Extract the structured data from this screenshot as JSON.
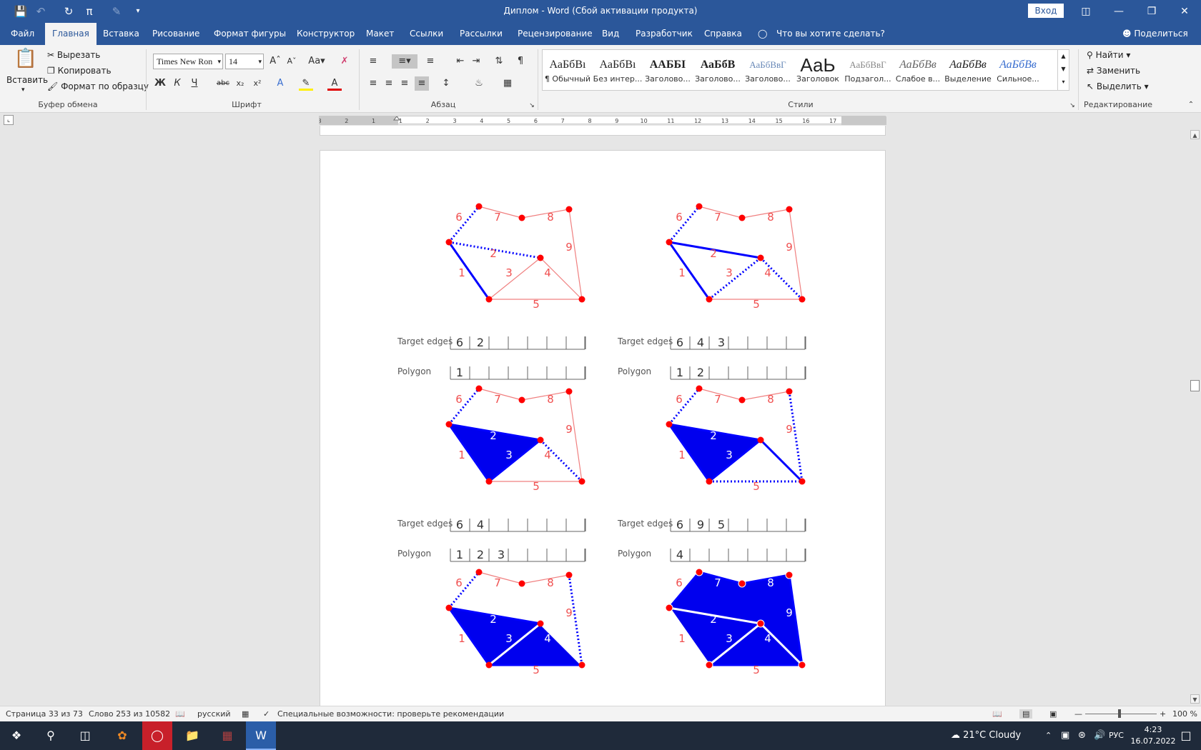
{
  "titlebar": {
    "title": "Диплом  -  Word (Сбой активации продукта)",
    "signin": "Вход"
  },
  "menu": {
    "items": [
      "Файл",
      "Главная",
      "Вставка",
      "Рисование",
      "Формат фигуры",
      "Конструктор",
      "Макет",
      "Ссылки",
      "Рассылки",
      "Рецензирование",
      "Вид",
      "Разработчик",
      "Справка"
    ],
    "search": "Что вы хотите сделать?",
    "share": "Поделиться"
  },
  "clipboard": {
    "paste": "Вставить",
    "cut": "Вырезать",
    "copy": "Копировать",
    "format_painter": "Формат по образцу",
    "label": "Буфер обмена"
  },
  "font": {
    "name": "Times New Ron",
    "size": "14",
    "bold": "Ж",
    "italic": "К",
    "underline": "Ч",
    "strike": "abc",
    "label": "Шрифт"
  },
  "paragraph": {
    "label": "Абзац"
  },
  "styles": {
    "label": "Стили",
    "items": [
      {
        "sample": "АаБбВı",
        "name": "¶ Обычный"
      },
      {
        "sample": "АаБбВı",
        "name": "Без интер..."
      },
      {
        "sample": "ААББІ",
        "name": "Заголово..."
      },
      {
        "sample": "АаБбВ",
        "name": "Заголово..."
      },
      {
        "sample": "АаБбВвГ",
        "name": "Заголово..."
      },
      {
        "sample": "АаЬ",
        "name": "Заголовок"
      },
      {
        "sample": "АаБбВвГ",
        "name": "Подзагол..."
      },
      {
        "sample": "АаБбВв",
        "name": "Слабое в..."
      },
      {
        "sample": "АаБбВв",
        "name": "Выделение"
      },
      {
        "sample": "АаБбВв",
        "name": "Сильное..."
      }
    ]
  },
  "editing": {
    "find": "Найти",
    "replace": "Заменить",
    "select": "Выделить",
    "label": "Редактирование"
  },
  "ruler": {
    "marks": [
      "3",
      "2",
      "1",
      "1",
      "2",
      "3",
      "4",
      "5",
      "6",
      "7",
      "8",
      "9",
      "10",
      "11",
      "12",
      "13",
      "14",
      "15",
      "16",
      "17"
    ]
  },
  "figure": {
    "panels": [
      {
        "target_label": "Target edges",
        "target": [
          "6",
          "2"
        ],
        "polygon_label": "Polygon",
        "polygon": [
          "1"
        ]
      },
      {
        "target_label": "Target edges",
        "target": [
          "6",
          "4",
          "3"
        ],
        "polygon_label": "Polygon",
        "polygon": [
          "1",
          "2"
        ]
      },
      {
        "target_label": "Target edges",
        "target": [
          "6",
          "4"
        ],
        "polygon_label": "Polygon",
        "polygon": [
          "1",
          "2",
          "3"
        ]
      },
      {
        "target_label": "Target edges",
        "target": [
          "6",
          "9",
          "5"
        ],
        "polygon_label": "Polygon",
        "polygon": [
          "4"
        ]
      },
      {
        "target_label": "",
        "target": [],
        "polygon_label": "",
        "polygon": []
      },
      {
        "target_label": "",
        "target": [],
        "polygon_label": "",
        "polygon": []
      }
    ],
    "edge_labels": [
      "1",
      "2",
      "3",
      "4",
      "5",
      "6",
      "7",
      "8",
      "9"
    ],
    "colors": {
      "vertex": "#ff0000",
      "edge": "#f08080",
      "label": "#f05050",
      "fill": "#0000ee",
      "active": "#0000ff"
    }
  },
  "status": {
    "page": "Страница 33 из 73",
    "words": "Слово 253 из 10582",
    "lang": "русский",
    "accessibility": "Специальные возможности: проверьте рекомендации",
    "zoom": "100 %"
  },
  "taskbar": {
    "weather": "21°C  Cloudy",
    "lang": "РУС",
    "time": "4:23",
    "date": "16.07.2022"
  }
}
